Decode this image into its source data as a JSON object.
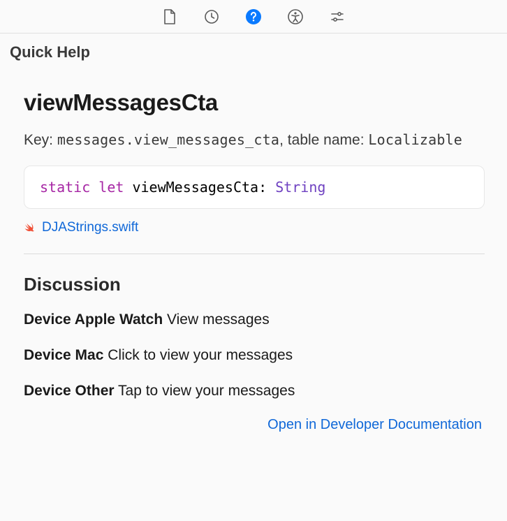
{
  "panel": {
    "title": "Quick Help"
  },
  "symbol": {
    "name": "viewMessagesCta",
    "key_label": "Key: ",
    "key_value": "messages.view_messages_cta",
    "table_label": ", table name: ",
    "table_value": "Localizable"
  },
  "declaration": {
    "kw_static": "static",
    "kw_let": "let",
    "identifier": "viewMessagesCta",
    "colon": ": ",
    "type": "String",
    "source_file": "DJAStrings.swift"
  },
  "discussion": {
    "heading": "Discussion",
    "items": [
      {
        "device": "Device Apple Watch",
        "text": "View messages"
      },
      {
        "device": "Device Mac",
        "text": "Click to view your messages"
      },
      {
        "device": "Device Other",
        "text": "Tap to view your messages"
      }
    ]
  },
  "footer": {
    "doc_link": "Open in Developer Documentation"
  },
  "icons": {
    "file": "file-icon",
    "history": "history-icon",
    "help": "help-icon",
    "accessibility": "accessibility-icon",
    "adjust": "adjust-icon",
    "swift": "swift-icon"
  }
}
